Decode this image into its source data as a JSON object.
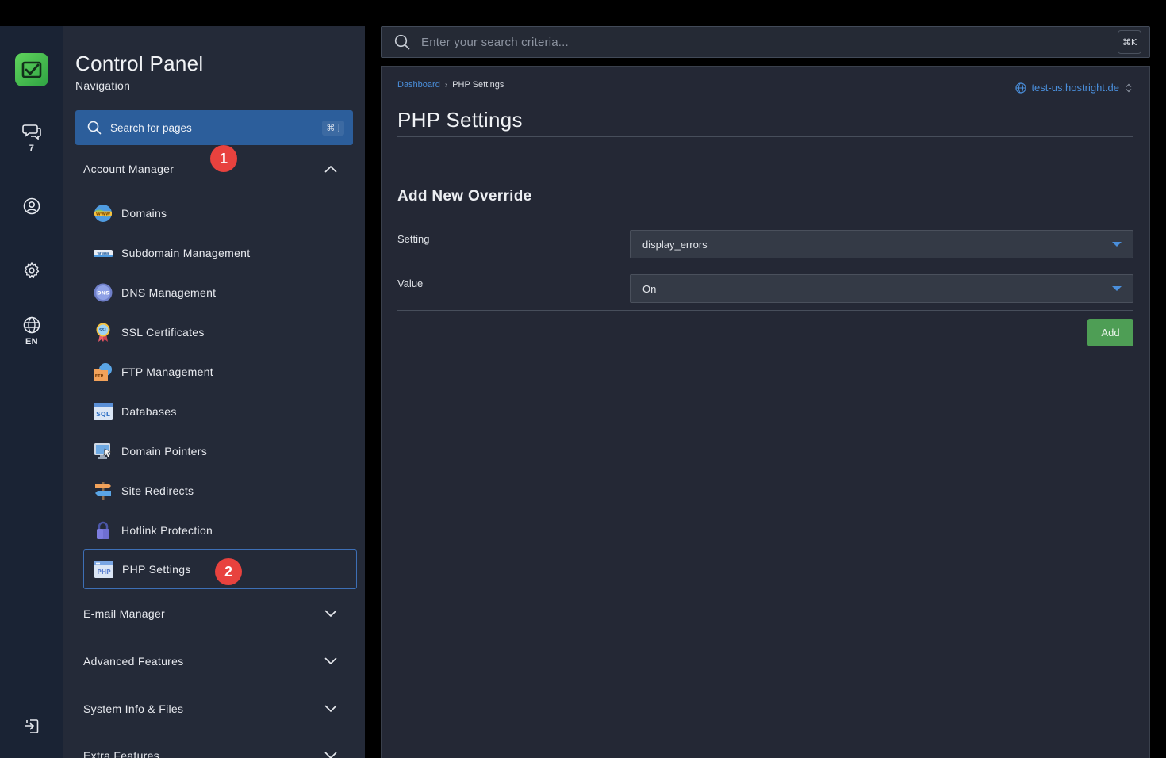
{
  "rail": {
    "chat_count": "7",
    "language": "EN"
  },
  "nav": {
    "title": "Control Panel",
    "subtitle": "Navigation",
    "search_placeholder": "Search for pages",
    "search_shortcut": "⌘ J",
    "badge1": "1",
    "badge2": "2",
    "sections": {
      "account_manager": "Account Manager",
      "email_manager": "E-mail Manager",
      "advanced_features": "Advanced Features",
      "system_info": "System Info & Files",
      "extra_features": "Extra Features"
    },
    "items": [
      {
        "label": "Domains",
        "icon": "www-globe-icon"
      },
      {
        "label": "Subdomain Management",
        "icon": "subdomain-icon"
      },
      {
        "label": "DNS Management",
        "icon": "dns-globe-icon"
      },
      {
        "label": "SSL Certificates",
        "icon": "ssl-badge-icon"
      },
      {
        "label": "FTP Management",
        "icon": "ftp-folder-icon"
      },
      {
        "label": "Databases",
        "icon": "sql-database-icon"
      },
      {
        "label": "Domain Pointers",
        "icon": "monitor-pointer-icon"
      },
      {
        "label": "Site Redirects",
        "icon": "signpost-icon"
      },
      {
        "label": "Hotlink Protection",
        "icon": "padlock-icon"
      },
      {
        "label": "PHP Settings",
        "icon": "php-window-icon",
        "active": true
      }
    ]
  },
  "main": {
    "search_placeholder": "Enter your search criteria...",
    "search_shortcut": "⌘K",
    "breadcrumb": {
      "root": "Dashboard",
      "current": "PHP Settings"
    },
    "domain": "test-us.hostright.de",
    "title": "PHP Settings",
    "section_title": "Add New Override",
    "setting_label": "Setting",
    "setting_value": "display_errors",
    "value_label": "Value",
    "value_value": "On",
    "add_button": "Add"
  },
  "colors": {
    "accent_blue": "#4a8fdc",
    "badge_red": "#e8423e",
    "add_green": "#4e9e55",
    "logo_green": "#3dba4e"
  }
}
